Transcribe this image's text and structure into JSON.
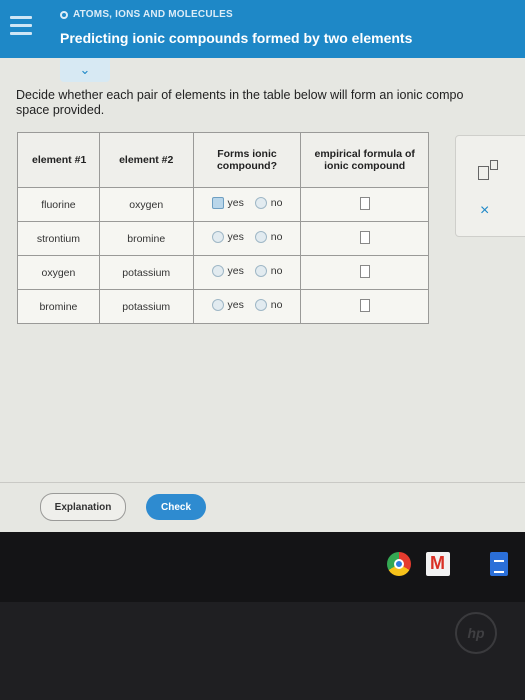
{
  "header": {
    "topic": "ATOMS, IONS AND MOLECULES",
    "title": "Predicting ionic compounds formed by two elements"
  },
  "instruction": "Decide whether each pair of elements in the table below will form an ionic compo\nspace provided.",
  "table": {
    "headers": {
      "element1": "element #1",
      "element2": "element #2",
      "forms": "Forms ionic\ncompound?",
      "formula": "empirical formula of\nionic compound"
    },
    "rows": [
      {
        "el1": "fluorine",
        "el2": "oxygen",
        "yes": "yes",
        "no": "no"
      },
      {
        "el1": "strontium",
        "el2": "bromine",
        "yes": "yes",
        "no": "no"
      },
      {
        "el1": "oxygen",
        "el2": "potassium",
        "yes": "yes",
        "no": "no"
      },
      {
        "el1": "bromine",
        "el2": "potassium",
        "yes": "yes",
        "no": "no"
      }
    ]
  },
  "side_panel": {
    "close": "×"
  },
  "buttons": {
    "explanation": "Explanation",
    "check": "Check"
  },
  "brand": {
    "logo": "hp"
  },
  "colors": {
    "header": "#1e88c7",
    "check_button": "#2e8bd0",
    "gmail_red": "#d93025",
    "docs_blue": "#2b6fd8"
  },
  "icons": [
    "hamburger-icon",
    "chevron-down-icon",
    "superscript-icon",
    "close-icon",
    "chrome-icon",
    "gmail-icon",
    "docs-icon"
  ]
}
